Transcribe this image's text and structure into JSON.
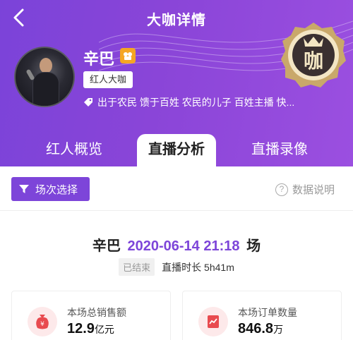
{
  "header": {
    "title": "大咖详情",
    "back_icon": "chevron-left-icon"
  },
  "profile": {
    "name": "辛巴",
    "badge_icon": "verified-badge-icon",
    "tag": "红人大咖",
    "bio": "出于农民 馈于百姓 农民的儿子 百姓主播 快...",
    "level_badge_text": "咖"
  },
  "tabs": [
    {
      "label": "红人概览",
      "active": false
    },
    {
      "label": "直播分析",
      "active": true
    },
    {
      "label": "直播录像",
      "active": false
    }
  ],
  "toolbar": {
    "filter_label": "场次选择",
    "explain_label": "数据说明"
  },
  "session": {
    "streamer": "辛巴",
    "datetime": "2020-06-14 21:18",
    "suffix": "场",
    "status": "已结束",
    "duration_label": "直播时长",
    "duration_value": "5h41m"
  },
  "stats": [
    {
      "label": "本场总销售额",
      "value": "12.9",
      "unit": "亿元",
      "icon": "money-bag-icon"
    },
    {
      "label": "本场订单数量",
      "value": "846.8",
      "unit": "万",
      "icon": "order-chart-icon"
    }
  ],
  "colors": {
    "primary": "#7d45d9",
    "header_gradient_start": "#7b43d9",
    "header_gradient_end": "#9b4fe0",
    "icon_red": "#e84a4f"
  }
}
